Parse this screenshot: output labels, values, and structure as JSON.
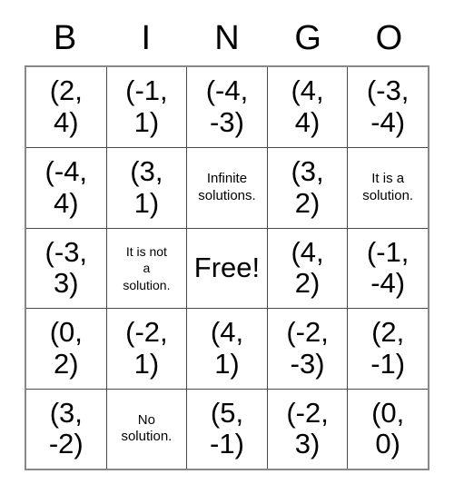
{
  "card": {
    "headers": [
      "B",
      "I",
      "N",
      "G",
      "O"
    ],
    "rows": [
      [
        {
          "text": "(2,\n4)",
          "kind": "coord"
        },
        {
          "text": "(-1,\n1)",
          "kind": "coord"
        },
        {
          "text": "(-4,\n-3)",
          "kind": "coord"
        },
        {
          "text": "(4,\n4)",
          "kind": "coord"
        },
        {
          "text": "(-3,\n-4)",
          "kind": "coord"
        }
      ],
      [
        {
          "text": "(-4,\n4)",
          "kind": "coord"
        },
        {
          "text": "(3,\n1)",
          "kind": "coord"
        },
        {
          "text": "Infinite\nsolutions.",
          "kind": "note"
        },
        {
          "text": "(3,\n2)",
          "kind": "coord"
        },
        {
          "text": "It is a\nsolution.",
          "kind": "note"
        }
      ],
      [
        {
          "text": "(-3,\n3)",
          "kind": "coord"
        },
        {
          "text": "It is not\na\nsolution.",
          "kind": "note-small"
        },
        {
          "text": "Free!",
          "kind": "free"
        },
        {
          "text": "(4,\n2)",
          "kind": "coord"
        },
        {
          "text": "(-1,\n-4)",
          "kind": "coord"
        }
      ],
      [
        {
          "text": "(0,\n2)",
          "kind": "coord"
        },
        {
          "text": "(-2,\n1)",
          "kind": "coord"
        },
        {
          "text": "(4,\n1)",
          "kind": "coord"
        },
        {
          "text": "(-2,\n-3)",
          "kind": "coord"
        },
        {
          "text": "(2,\n-1)",
          "kind": "coord"
        }
      ],
      [
        {
          "text": "(3,\n-2)",
          "kind": "coord"
        },
        {
          "text": "No\nsolution.",
          "kind": "note"
        },
        {
          "text": "(5,\n-1)",
          "kind": "coord"
        },
        {
          "text": "(-2,\n3)",
          "kind": "coord"
        },
        {
          "text": "(0,\n0)",
          "kind": "coord"
        }
      ]
    ],
    "colors": {
      "text": "#000000",
      "grid_line": "#4a4a4a",
      "outer_border": "#888888",
      "background": "#ffffff"
    }
  }
}
